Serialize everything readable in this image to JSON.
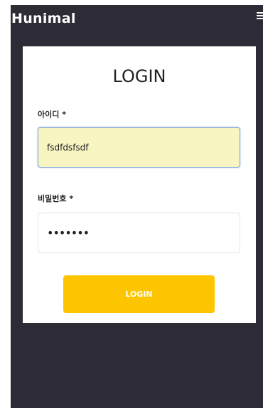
{
  "header": {
    "logo": "Hunimal",
    "menu_icon": "hamburger-menu-icon"
  },
  "login": {
    "title": "LOGIN",
    "id_label": "아이디",
    "pw_label": "비밀번호",
    "required_mark": "*",
    "id_value": "fsdfdsfsdf",
    "pw_value": "•••••••",
    "button_label": "LOGIN"
  },
  "colors": {
    "background": "#2d2b36",
    "button": "#fdc500",
    "autofill": "#f7f6c3"
  }
}
